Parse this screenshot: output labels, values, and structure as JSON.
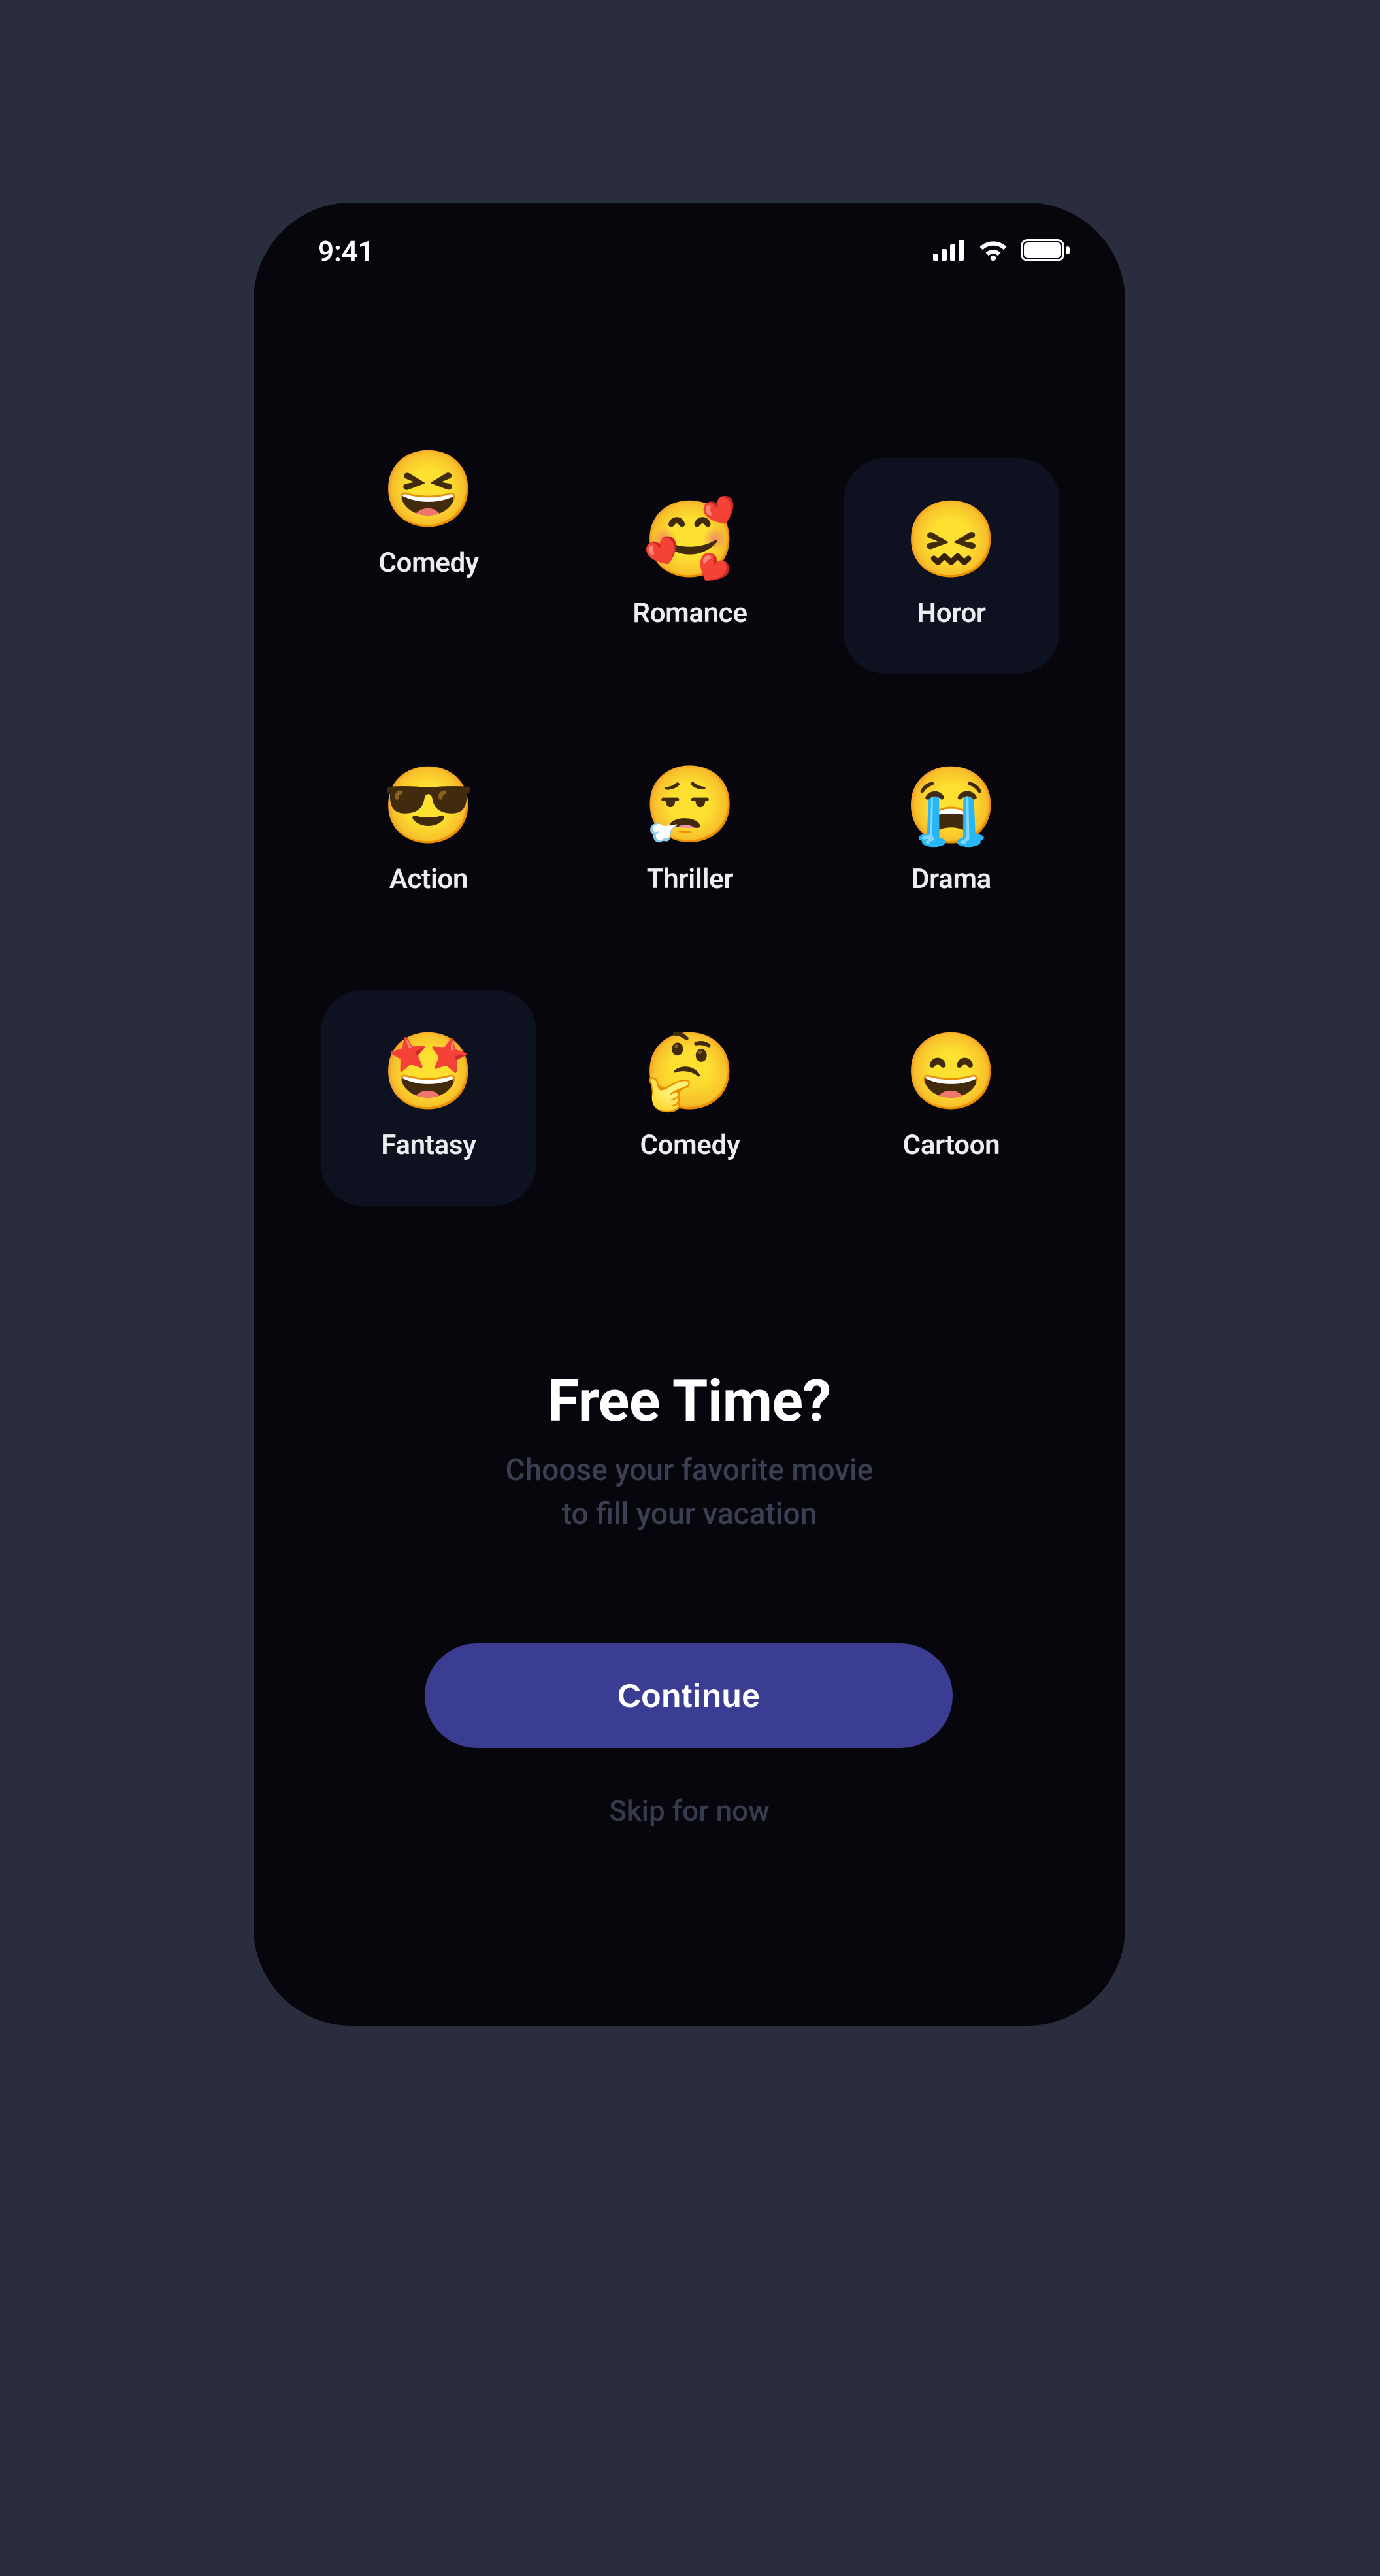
{
  "statusbar": {
    "time": "9:41"
  },
  "categories": [
    {
      "emoji": "😆",
      "label": "Comedy",
      "column": "a",
      "selected": false
    },
    {
      "emoji": "🥰",
      "label": "Romance",
      "column": "b",
      "selected": false
    },
    {
      "emoji": "😖",
      "label": "Horor",
      "column": "a",
      "selected": true
    },
    {
      "emoji": "😎",
      "label": "Action",
      "column": "a",
      "selected": false
    },
    {
      "emoji": "😮‍💨",
      "label": "Thriller",
      "column": "b",
      "selected": false
    },
    {
      "emoji": "😭",
      "label": "Drama",
      "column": "a",
      "selected": false
    },
    {
      "emoji": "🤩",
      "label": "Fantasy",
      "column": "a",
      "selected": true
    },
    {
      "emoji": "🤔",
      "label": "Comedy",
      "column": "b",
      "selected": false
    },
    {
      "emoji": "😄",
      "label": "Cartoon",
      "column": "a",
      "selected": false
    }
  ],
  "headline": "Free Time?",
  "subtext": "Choose your favorite movie\nto fill your vacation",
  "buttons": {
    "continue": "Continue",
    "skip": "Skip for now"
  }
}
